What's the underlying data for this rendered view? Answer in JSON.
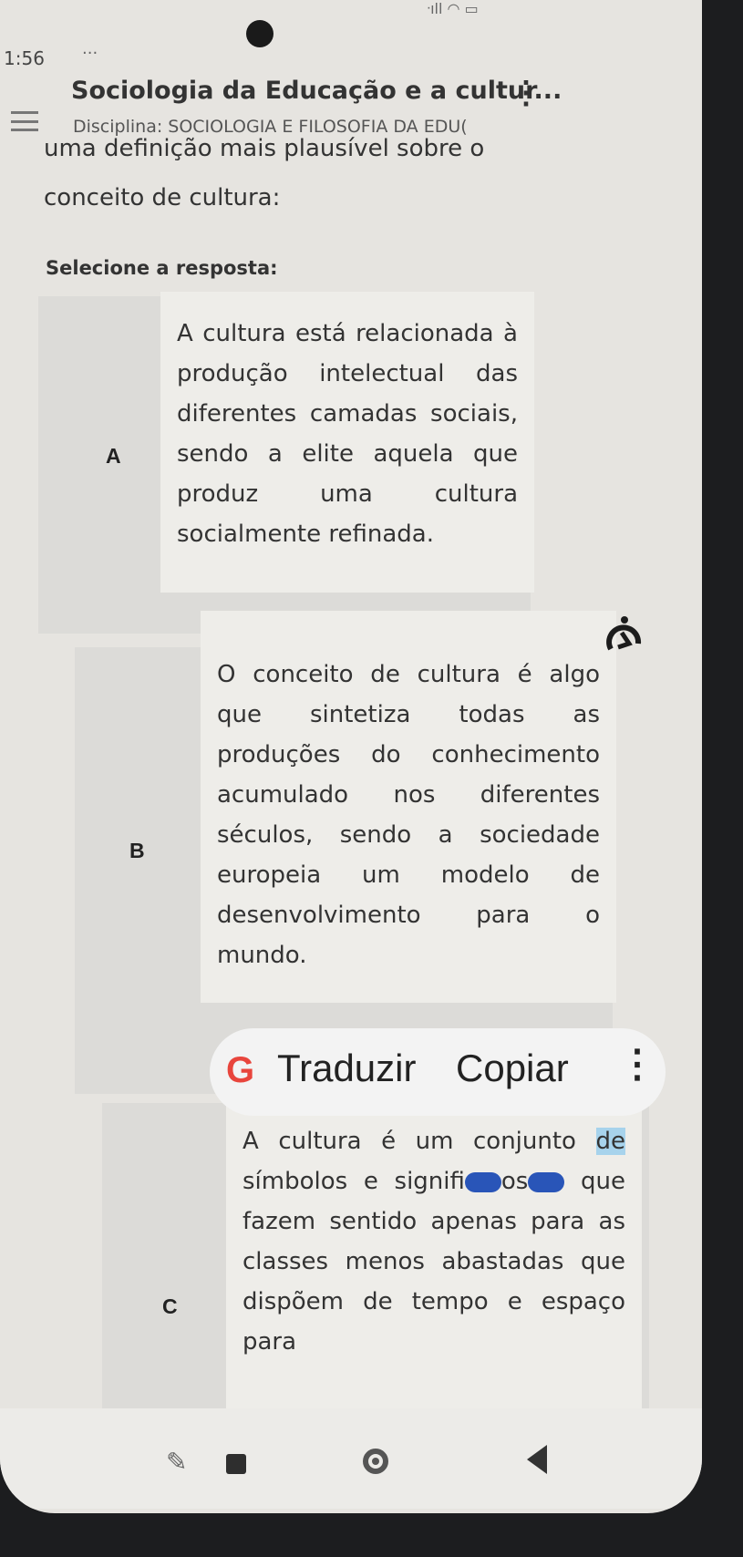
{
  "status": {
    "time": "1:56",
    "dots": "···",
    "signal": "ᐧıll ◠ ▭"
  },
  "app": {
    "title": "Sociologia da Educação e a cultur...",
    "subtitle": "Disciplina: SOCIOLOGIA E FILOSOFIA DA EDU("
  },
  "question": {
    "text": "uma definição mais plausível sobre o conceito de cultura:"
  },
  "answer_prompt": "Selecione a resposta:",
  "options": [
    {
      "letter": "A",
      "text": "A cultura está relacionada à produção intelectual das diferentes camadas sociais, sendo a elite aquela que produz uma cultura socialmente refinada."
    },
    {
      "letter": "B",
      "text": "O conceito de cultura é algo que sintetiza todas as produções do conhecimento acumulado nos diferentes séculos, sendo a sociedade europeia um modelo de desenvolvimento para o mundo."
    },
    {
      "letter": "C",
      "text_before": "A cultura é um conjunto ",
      "text_highlight": "de",
      "text_mid": " símbolos e signifi",
      "text_sel": "os",
      "text_after": " que fazem sentido apenas para as classes menos abastadas que dispõem de tempo e espaço para"
    }
  ],
  "popup": {
    "icon": "google-g-icon",
    "translate": "Traduzir",
    "copy": "Copiar",
    "more": "⋮"
  },
  "nav": {
    "recent": "recent-apps-icon",
    "home": "home-icon",
    "back": "back-icon"
  },
  "colors": {
    "background": "#e6e4e0",
    "highlight": "#a7d3ec",
    "selection": "#2955b8",
    "google_red": "#e8453c"
  }
}
